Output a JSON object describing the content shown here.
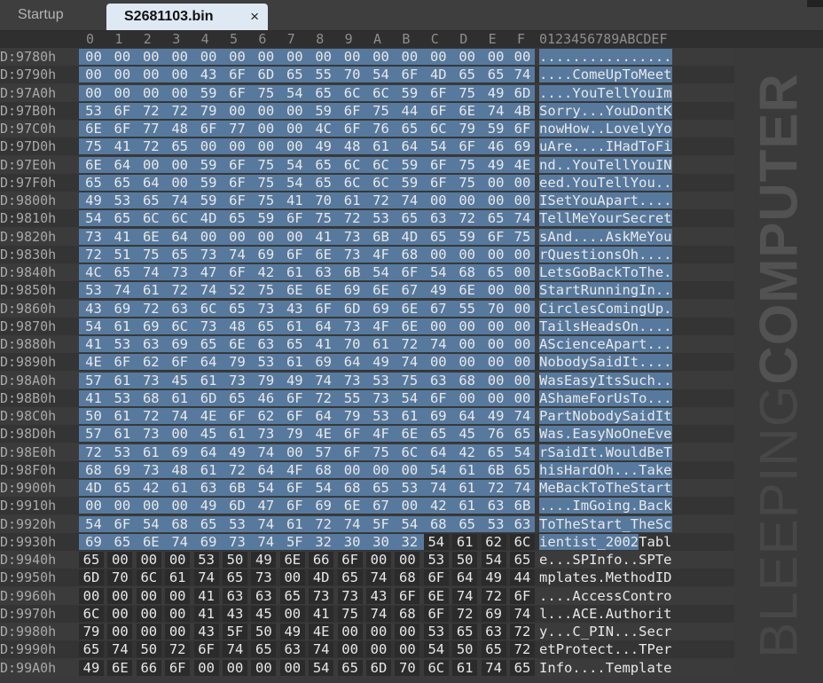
{
  "tabs": [
    {
      "label": "Startup",
      "active": false
    },
    {
      "label": "S2681103.bin",
      "active": true,
      "close": "×"
    }
  ],
  "columns": [
    "0",
    "1",
    "2",
    "3",
    "4",
    "5",
    "6",
    "7",
    "8",
    "9",
    "A",
    "B",
    "C",
    "D",
    "E",
    "F"
  ],
  "ascii_header": "0123456789ABCDEF",
  "selection_color": "#57799d",
  "watermark": {
    "light": "BLEEPING",
    "bold": "COMPUTER"
  },
  "rows": [
    {
      "addr": "D:9780h",
      "bytes": [
        "00",
        "00",
        "00",
        "00",
        "00",
        "00",
        "00",
        "00",
        "00",
        "00",
        "00",
        "00",
        "00",
        "00",
        "00",
        "00"
      ],
      "ascii": "................",
      "sel_start": 0,
      "sel_end": 15
    },
    {
      "addr": "D:9790h",
      "bytes": [
        "00",
        "00",
        "00",
        "00",
        "43",
        "6F",
        "6D",
        "65",
        "55",
        "70",
        "54",
        "6F",
        "4D",
        "65",
        "65",
        "74"
      ],
      "ascii": "....ComeUpToMeet",
      "sel_start": 0,
      "sel_end": 15
    },
    {
      "addr": "D:97A0h",
      "bytes": [
        "00",
        "00",
        "00",
        "00",
        "59",
        "6F",
        "75",
        "54",
        "65",
        "6C",
        "6C",
        "59",
        "6F",
        "75",
        "49",
        "6D"
      ],
      "ascii": "....YouTellYouIm",
      "sel_start": 0,
      "sel_end": 15
    },
    {
      "addr": "D:97B0h",
      "bytes": [
        "53",
        "6F",
        "72",
        "72",
        "79",
        "00",
        "00",
        "00",
        "59",
        "6F",
        "75",
        "44",
        "6F",
        "6E",
        "74",
        "4B"
      ],
      "ascii": "Sorry...YouDontK",
      "sel_start": 0,
      "sel_end": 15
    },
    {
      "addr": "D:97C0h",
      "bytes": [
        "6E",
        "6F",
        "77",
        "48",
        "6F",
        "77",
        "00",
        "00",
        "4C",
        "6F",
        "76",
        "65",
        "6C",
        "79",
        "59",
        "6F"
      ],
      "ascii": "nowHow..LovelyYo",
      "sel_start": 0,
      "sel_end": 15
    },
    {
      "addr": "D:97D0h",
      "bytes": [
        "75",
        "41",
        "72",
        "65",
        "00",
        "00",
        "00",
        "00",
        "49",
        "48",
        "61",
        "64",
        "54",
        "6F",
        "46",
        "69"
      ],
      "ascii": "uAre....IHadToFi",
      "sel_start": 0,
      "sel_end": 15
    },
    {
      "addr": "D:97E0h",
      "bytes": [
        "6E",
        "64",
        "00",
        "00",
        "59",
        "6F",
        "75",
        "54",
        "65",
        "6C",
        "6C",
        "59",
        "6F",
        "75",
        "49",
        "4E"
      ],
      "ascii": "nd..YouTellYouIN",
      "sel_start": 0,
      "sel_end": 15
    },
    {
      "addr": "D:97F0h",
      "bytes": [
        "65",
        "65",
        "64",
        "00",
        "59",
        "6F",
        "75",
        "54",
        "65",
        "6C",
        "6C",
        "59",
        "6F",
        "75",
        "00",
        "00"
      ],
      "ascii": "eed.YouTellYou..",
      "sel_start": 0,
      "sel_end": 15
    },
    {
      "addr": "D:9800h",
      "bytes": [
        "49",
        "53",
        "65",
        "74",
        "59",
        "6F",
        "75",
        "41",
        "70",
        "61",
        "72",
        "74",
        "00",
        "00",
        "00",
        "00"
      ],
      "ascii": "ISetYouApart....",
      "sel_start": 0,
      "sel_end": 15
    },
    {
      "addr": "D:9810h",
      "bytes": [
        "54",
        "65",
        "6C",
        "6C",
        "4D",
        "65",
        "59",
        "6F",
        "75",
        "72",
        "53",
        "65",
        "63",
        "72",
        "65",
        "74"
      ],
      "ascii": "TellMeYourSecret",
      "sel_start": 0,
      "sel_end": 15
    },
    {
      "addr": "D:9820h",
      "bytes": [
        "73",
        "41",
        "6E",
        "64",
        "00",
        "00",
        "00",
        "00",
        "41",
        "73",
        "6B",
        "4D",
        "65",
        "59",
        "6F",
        "75"
      ],
      "ascii": "sAnd....AskMeYou",
      "sel_start": 0,
      "sel_end": 15
    },
    {
      "addr": "D:9830h",
      "bytes": [
        "72",
        "51",
        "75",
        "65",
        "73",
        "74",
        "69",
        "6F",
        "6E",
        "73",
        "4F",
        "68",
        "00",
        "00",
        "00",
        "00"
      ],
      "ascii": "rQuestionsOh....",
      "sel_start": 0,
      "sel_end": 15
    },
    {
      "addr": "D:9840h",
      "bytes": [
        "4C",
        "65",
        "74",
        "73",
        "47",
        "6F",
        "42",
        "61",
        "63",
        "6B",
        "54",
        "6F",
        "54",
        "68",
        "65",
        "00"
      ],
      "ascii": "LetsGoBackToThe.",
      "sel_start": 0,
      "sel_end": 15
    },
    {
      "addr": "D:9850h",
      "bytes": [
        "53",
        "74",
        "61",
        "72",
        "74",
        "52",
        "75",
        "6E",
        "6E",
        "69",
        "6E",
        "67",
        "49",
        "6E",
        "00",
        "00"
      ],
      "ascii": "StartRunningIn..",
      "sel_start": 0,
      "sel_end": 15
    },
    {
      "addr": "D:9860h",
      "bytes": [
        "43",
        "69",
        "72",
        "63",
        "6C",
        "65",
        "73",
        "43",
        "6F",
        "6D",
        "69",
        "6E",
        "67",
        "55",
        "70",
        "00"
      ],
      "ascii": "CirclesComingUp.",
      "sel_start": 0,
      "sel_end": 15
    },
    {
      "addr": "D:9870h",
      "bytes": [
        "54",
        "61",
        "69",
        "6C",
        "73",
        "48",
        "65",
        "61",
        "64",
        "73",
        "4F",
        "6E",
        "00",
        "00",
        "00",
        "00"
      ],
      "ascii": "TailsHeadsOn....",
      "sel_start": 0,
      "sel_end": 15
    },
    {
      "addr": "D:9880h",
      "bytes": [
        "41",
        "53",
        "63",
        "69",
        "65",
        "6E",
        "63",
        "65",
        "41",
        "70",
        "61",
        "72",
        "74",
        "00",
        "00",
        "00"
      ],
      "ascii": "AScienceApart...",
      "sel_start": 0,
      "sel_end": 15
    },
    {
      "addr": "D:9890h",
      "bytes": [
        "4E",
        "6F",
        "62",
        "6F",
        "64",
        "79",
        "53",
        "61",
        "69",
        "64",
        "49",
        "74",
        "00",
        "00",
        "00",
        "00"
      ],
      "ascii": "NobodySaidIt....",
      "sel_start": 0,
      "sel_end": 15
    },
    {
      "addr": "D:98A0h",
      "bytes": [
        "57",
        "61",
        "73",
        "45",
        "61",
        "73",
        "79",
        "49",
        "74",
        "73",
        "53",
        "75",
        "63",
        "68",
        "00",
        "00"
      ],
      "ascii": "WasEasyItsSuch..",
      "sel_start": 0,
      "sel_end": 15
    },
    {
      "addr": "D:98B0h",
      "bytes": [
        "41",
        "53",
        "68",
        "61",
        "6D",
        "65",
        "46",
        "6F",
        "72",
        "55",
        "73",
        "54",
        "6F",
        "00",
        "00",
        "00"
      ],
      "ascii": "AShameForUsTo...",
      "sel_start": 0,
      "sel_end": 15
    },
    {
      "addr": "D:98C0h",
      "bytes": [
        "50",
        "61",
        "72",
        "74",
        "4E",
        "6F",
        "62",
        "6F",
        "64",
        "79",
        "53",
        "61",
        "69",
        "64",
        "49",
        "74"
      ],
      "ascii": "PartNobodySaidIt",
      "sel_start": 0,
      "sel_end": 15
    },
    {
      "addr": "D:98D0h",
      "bytes": [
        "57",
        "61",
        "73",
        "00",
        "45",
        "61",
        "73",
        "79",
        "4E",
        "6F",
        "4F",
        "6E",
        "65",
        "45",
        "76",
        "65"
      ],
      "ascii": "Was.EasyNoOneEve",
      "sel_start": 0,
      "sel_end": 15
    },
    {
      "addr": "D:98E0h",
      "bytes": [
        "72",
        "53",
        "61",
        "69",
        "64",
        "49",
        "74",
        "00",
        "57",
        "6F",
        "75",
        "6C",
        "64",
        "42",
        "65",
        "54"
      ],
      "ascii": "rSaidIt.WouldBeT",
      "sel_start": 0,
      "sel_end": 15
    },
    {
      "addr": "D:98F0h",
      "bytes": [
        "68",
        "69",
        "73",
        "48",
        "61",
        "72",
        "64",
        "4F",
        "68",
        "00",
        "00",
        "00",
        "54",
        "61",
        "6B",
        "65"
      ],
      "ascii": "hisHardOh...Take",
      "sel_start": 0,
      "sel_end": 15
    },
    {
      "addr": "D:9900h",
      "bytes": [
        "4D",
        "65",
        "42",
        "61",
        "63",
        "6B",
        "54",
        "6F",
        "54",
        "68",
        "65",
        "53",
        "74",
        "61",
        "72",
        "74"
      ],
      "ascii": "MeBackToTheStart",
      "sel_start": 0,
      "sel_end": 15
    },
    {
      "addr": "D:9910h",
      "bytes": [
        "00",
        "00",
        "00",
        "00",
        "49",
        "6D",
        "47",
        "6F",
        "69",
        "6E",
        "67",
        "00",
        "42",
        "61",
        "63",
        "6B"
      ],
      "ascii": "....ImGoing.Back",
      "sel_start": 0,
      "sel_end": 15
    },
    {
      "addr": "D:9920h",
      "bytes": [
        "54",
        "6F",
        "54",
        "68",
        "65",
        "53",
        "74",
        "61",
        "72",
        "74",
        "5F",
        "54",
        "68",
        "65",
        "53",
        "63"
      ],
      "ascii": "ToTheStart_TheSc",
      "sel_start": 0,
      "sel_end": 15
    },
    {
      "addr": "D:9930h",
      "bytes": [
        "69",
        "65",
        "6E",
        "74",
        "69",
        "73",
        "74",
        "5F",
        "32",
        "30",
        "30",
        "32",
        "54",
        "61",
        "62",
        "6C"
      ],
      "ascii": "ientist_2002Tabl",
      "sel_start": 0,
      "sel_end": 11
    },
    {
      "addr": "D:9940h",
      "bytes": [
        "65",
        "00",
        "00",
        "00",
        "53",
        "50",
        "49",
        "6E",
        "66",
        "6F",
        "00",
        "00",
        "53",
        "50",
        "54",
        "65"
      ],
      "ascii": "e...SPInfo..SPTe",
      "sel_start": -1,
      "sel_end": -1
    },
    {
      "addr": "D:9950h",
      "bytes": [
        "6D",
        "70",
        "6C",
        "61",
        "74",
        "65",
        "73",
        "00",
        "4D",
        "65",
        "74",
        "68",
        "6F",
        "64",
        "49",
        "44"
      ],
      "ascii": "mplates.MethodID",
      "sel_start": -1,
      "sel_end": -1
    },
    {
      "addr": "D:9960h",
      "bytes": [
        "00",
        "00",
        "00",
        "00",
        "41",
        "63",
        "63",
        "65",
        "73",
        "73",
        "43",
        "6F",
        "6E",
        "74",
        "72",
        "6F"
      ],
      "ascii": "....AccessContro",
      "sel_start": -1,
      "sel_end": -1
    },
    {
      "addr": "D:9970h",
      "bytes": [
        "6C",
        "00",
        "00",
        "00",
        "41",
        "43",
        "45",
        "00",
        "41",
        "75",
        "74",
        "68",
        "6F",
        "72",
        "69",
        "74"
      ],
      "ascii": "l...ACE.Authorit",
      "sel_start": -1,
      "sel_end": -1
    },
    {
      "addr": "D:9980h",
      "bytes": [
        "79",
        "00",
        "00",
        "00",
        "43",
        "5F",
        "50",
        "49",
        "4E",
        "00",
        "00",
        "00",
        "53",
        "65",
        "63",
        "72"
      ],
      "ascii": "y...C_PIN...Secr",
      "sel_start": -1,
      "sel_end": -1
    },
    {
      "addr": "D:9990h",
      "bytes": [
        "65",
        "74",
        "50",
        "72",
        "6F",
        "74",
        "65",
        "63",
        "74",
        "00",
        "00",
        "00",
        "54",
        "50",
        "65",
        "72"
      ],
      "ascii": "etProtect...TPer",
      "sel_start": -1,
      "sel_end": -1
    },
    {
      "addr": "D:99A0h",
      "bytes": [
        "49",
        "6E",
        "66",
        "6F",
        "00",
        "00",
        "00",
        "00",
        "54",
        "65",
        "6D",
        "70",
        "6C",
        "61",
        "74",
        "65"
      ],
      "ascii": "Info....Template",
      "sel_start": -1,
      "sel_end": -1
    }
  ]
}
